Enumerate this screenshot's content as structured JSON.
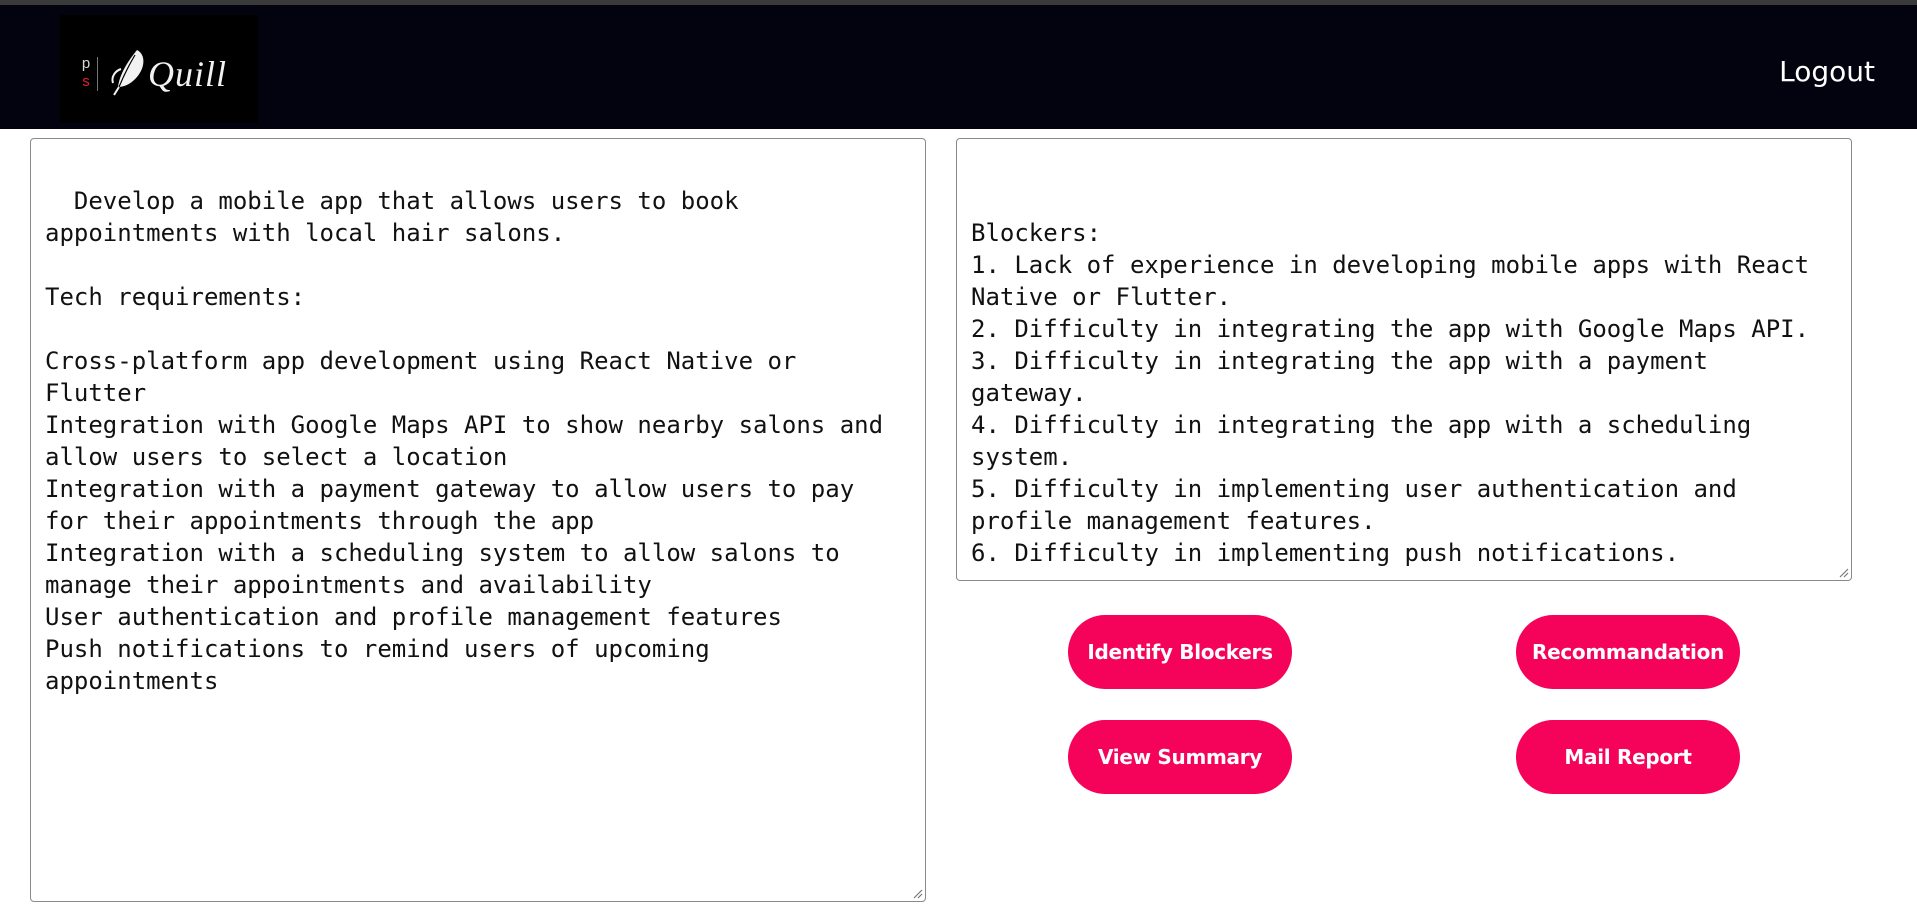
{
  "header": {
    "logo": {
      "mark_top": "p",
      "mark_bottom": "s",
      "brand": "Quill"
    },
    "logout_label": "Logout"
  },
  "input_panel": {
    "text": "Develop a mobile app that allows users to book\nappointments with local hair salons.\n\nTech requirements:\n\nCross-platform app development using React Native or\nFlutter\nIntegration with Google Maps API to show nearby salons and\nallow users to select a location\nIntegration with a payment gateway to allow users to pay\nfor their appointments through the app\nIntegration with a scheduling system to allow salons to\nmanage their appointments and availability\nUser authentication and profile management features\nPush notifications to remind users of upcoming\nappointments"
  },
  "output_panel": {
    "text": "\nBlockers:\n1. Lack of experience in developing mobile apps with React\nNative or Flutter.\n2. Difficulty in integrating the app with Google Maps API.\n3. Difficulty in integrating the app with a payment\ngateway.\n4. Difficulty in integrating the app with a scheduling\nsystem.\n5. Difficulty in implementing user authentication and\nprofile management features.\n6. Difficulty in implementing push notifications."
  },
  "actions": {
    "identify_blockers": "Identify Blockers",
    "recommendation": "Recommandation",
    "view_summary": "View Summary",
    "mail_report": "Mail Report"
  },
  "colors": {
    "navbar_bg": "#03030f",
    "button_bg": "#f5035a",
    "button_text": "#ffffff"
  },
  "icons": {
    "logo_icon": "feather-quill-icon",
    "resize_handle": "resize-grip-icon"
  }
}
